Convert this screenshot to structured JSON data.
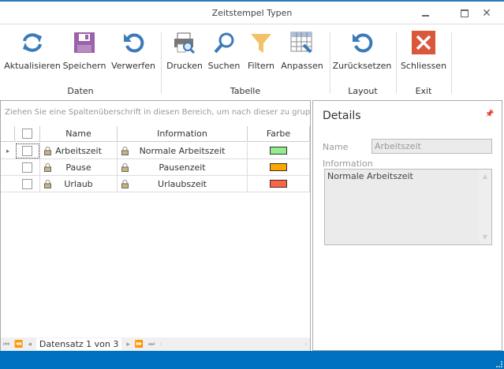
{
  "window": {
    "title": "Zeitstempel Typen",
    "minimize_icon": "minimize-icon",
    "maximize_icon": "maximize-icon",
    "close_icon": "close-icon"
  },
  "ribbon": {
    "groups": [
      {
        "label": "Daten",
        "buttons": [
          {
            "label": "Aktualisieren",
            "icon": "refresh-icon"
          },
          {
            "label": "Speichern",
            "icon": "save-icon"
          },
          {
            "label": "Verwerfen",
            "icon": "undo-icon"
          }
        ]
      },
      {
        "label": "Tabelle",
        "buttons": [
          {
            "label": "Drucken",
            "icon": "print-preview-icon"
          },
          {
            "label": "Suchen",
            "icon": "search-icon"
          },
          {
            "label": "Filtern",
            "icon": "filter-icon"
          },
          {
            "label": "Anpassen",
            "icon": "customize-grid-icon"
          }
        ]
      },
      {
        "label": "Layout",
        "buttons": [
          {
            "label": "Zurücksetzen",
            "icon": "reset-icon"
          }
        ]
      },
      {
        "label": "Exit",
        "buttons": [
          {
            "label": "Schliessen",
            "icon": "close-icon"
          }
        ]
      }
    ]
  },
  "grid": {
    "group_panel_text": "Ziehen Sie eine Spaltenüberschrift in diesen Bereich, um nach dieser zu gruppier",
    "columns": [
      "Name",
      "Information",
      "Farbe"
    ],
    "rows": [
      {
        "name": "Arbeitszeit",
        "information": "Normale Arbeitszeit",
        "color": "#90ee90",
        "selected": true
      },
      {
        "name": "Pause",
        "information": "Pausenzeit",
        "color": "#ffa500",
        "selected": false
      },
      {
        "name": "Urlaub",
        "information": "Urlaubszeit",
        "color": "#ff6347",
        "selected": false
      }
    ],
    "navigator": {
      "text": "Datensatz 1 von 3"
    }
  },
  "details": {
    "title": "Details",
    "name_label": "Name",
    "name_value": "Arbeitszeit",
    "info_label": "Information",
    "info_value": "Normale Arbeitszeit"
  },
  "colors": {
    "accent": "#0070c0"
  }
}
